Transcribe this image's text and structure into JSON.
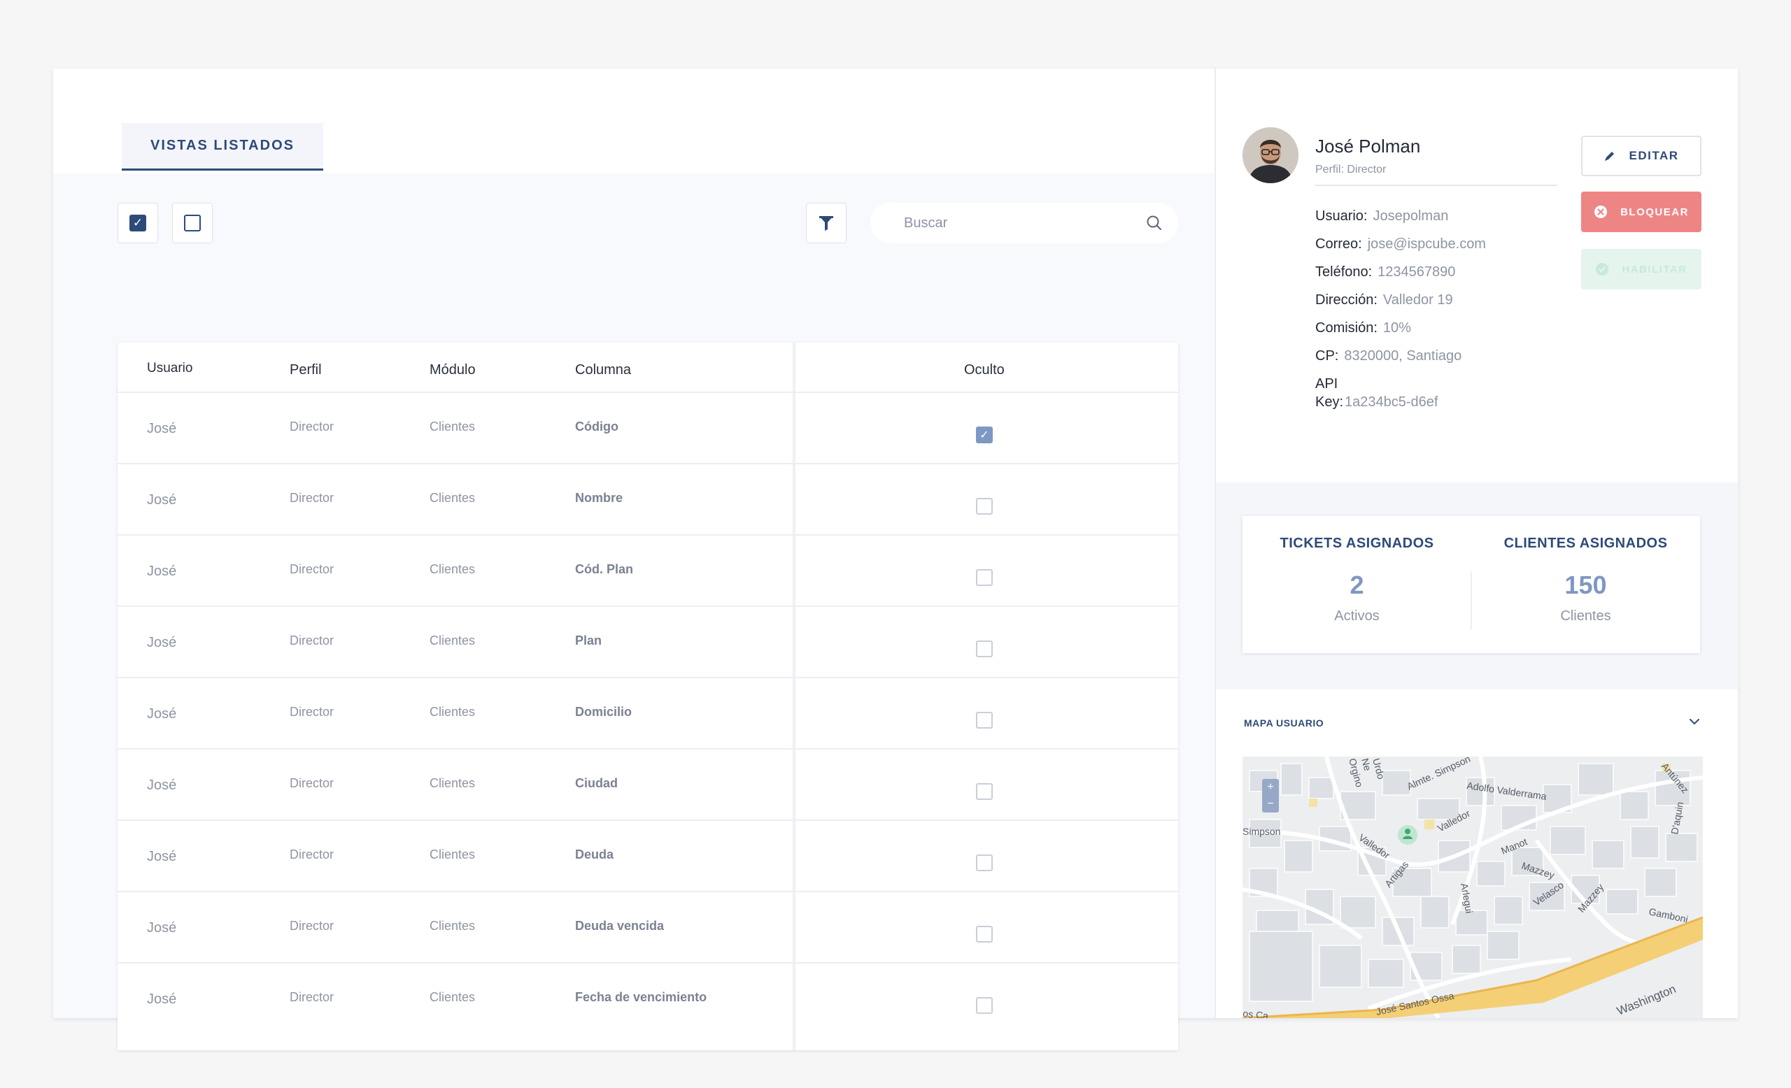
{
  "tabs": [
    {
      "label": "VISTAS LISTADOS"
    }
  ],
  "search": {
    "placeholder": "Buscar"
  },
  "table": {
    "headers": {
      "usuario": "Usuario",
      "perfil": "Perfil",
      "modulo": "Módulo",
      "columna": "Columna",
      "oculto": "Oculto"
    },
    "rows": [
      {
        "usuario": "José",
        "perfil": "Director",
        "modulo": "Clientes",
        "columna": "Código",
        "oculto": true
      },
      {
        "usuario": "José",
        "perfil": "Director",
        "modulo": "Clientes",
        "columna": "Nombre",
        "oculto": false
      },
      {
        "usuario": "José",
        "perfil": "Director",
        "modulo": "Clientes",
        "columna": "Cód. Plan",
        "oculto": false
      },
      {
        "usuario": "José",
        "perfil": "Director",
        "modulo": "Clientes",
        "columna": "Plan",
        "oculto": false
      },
      {
        "usuario": "José",
        "perfil": "Director",
        "modulo": "Clientes",
        "columna": "Domicilio",
        "oculto": false
      },
      {
        "usuario": "José",
        "perfil": "Director",
        "modulo": "Clientes",
        "columna": "Ciudad",
        "oculto": false
      },
      {
        "usuario": "José",
        "perfil": "Director",
        "modulo": "Clientes",
        "columna": "Deuda",
        "oculto": false
      },
      {
        "usuario": "José",
        "perfil": "Director",
        "modulo": "Clientes",
        "columna": "Deuda vencida",
        "oculto": false
      },
      {
        "usuario": "José",
        "perfil": "Director",
        "modulo": "Clientes",
        "columna": "Fecha de vencimiento",
        "oculto": false
      }
    ]
  },
  "profile": {
    "name": "José Polman",
    "role": "Perfil: Director",
    "fields": [
      {
        "label": "Usuario:",
        "value": "Josepolman"
      },
      {
        "label": "Correo:",
        "value": "jose@ispcube.com"
      },
      {
        "label": "Teléfono:",
        "value": "1234567890"
      },
      {
        "label": "Dirección:",
        "value": "Valledor 19"
      },
      {
        "label": "Comisión:",
        "value": "10%"
      },
      {
        "label": "CP:",
        "value": "8320000, Santiago"
      }
    ],
    "api_label_1": "API",
    "api_label_2": "Key:",
    "api_value": "1a234bc5-d6ef"
  },
  "actions": {
    "edit": "EDITAR",
    "block": "BLOQUEAR",
    "enable": "HABILITAR"
  },
  "stats": {
    "tickets": {
      "title": "TICKETS ASIGNADOS",
      "value": "2",
      "sub": "Activos"
    },
    "clients": {
      "title": "CLIENTES ASIGNADOS",
      "value": "150",
      "sub": "Clientes"
    }
  },
  "map": {
    "title": "MAPA USUARIO",
    "zoom_in": "+",
    "zoom_out": "−",
    "streets": [
      "Almte. Simpson",
      "Adolfo Valderrama",
      "Valledor",
      "Valledor",
      "Artigas",
      "Manot",
      "Mazzey",
      "Velasco",
      "Mazzey",
      "Arlegui",
      "Gamboni",
      "José Santos Ossa",
      "Washington",
      "D'aquin",
      "Antúnez",
      "Simpson",
      "Urdo",
      "Orgino",
      "Ne",
      "os Ca"
    ]
  },
  "colors": {
    "accent": "#2e4a78",
    "accent_light": "#7e98c4",
    "danger": "#ee8585",
    "success_light": "#e5f5ee"
  },
  "icons": [
    "check-icon",
    "filter-icon",
    "search-icon",
    "pencil-icon",
    "x-circle-icon",
    "check-circle-icon",
    "chevron-down-icon",
    "user-pin-icon"
  ]
}
